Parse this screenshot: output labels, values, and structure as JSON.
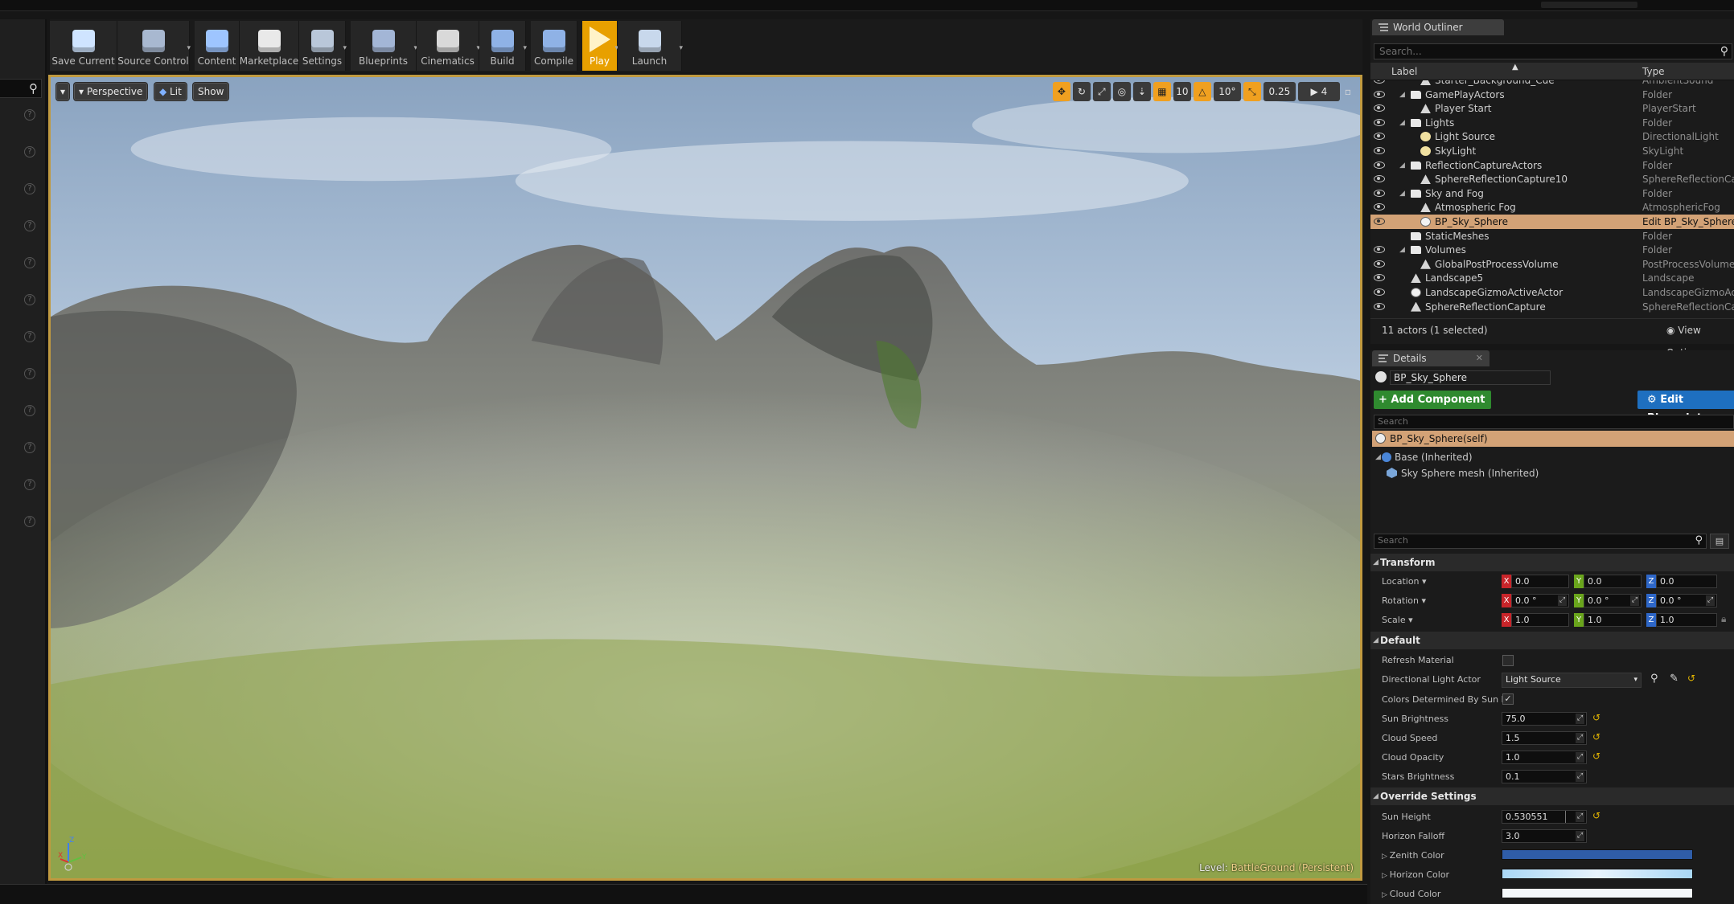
{
  "toolbar": {
    "buttons": [
      {
        "label": "Save Current",
        "icon": "save-icon"
      },
      {
        "label": "Source Control",
        "icon": "source-control-icon"
      },
      {
        "label": "Content",
        "icon": "content-icon"
      },
      {
        "label": "Marketplace",
        "icon": "marketplace-icon"
      },
      {
        "label": "Settings",
        "icon": "settings-icon"
      },
      {
        "label": "Blueprints",
        "icon": "blueprints-icon"
      },
      {
        "label": "Cinematics",
        "icon": "cinematics-icon"
      },
      {
        "label": "Build",
        "icon": "build-icon"
      },
      {
        "label": "Compile",
        "icon": "compile-icon"
      },
      {
        "label": "Play",
        "icon": "play-icon"
      },
      {
        "label": "Launch",
        "icon": "launch-icon"
      }
    ]
  },
  "viewport": {
    "perspective": "Perspective",
    "lit": "Lit",
    "show": "Show",
    "grid_snap": "10",
    "rotation_snap": "10°",
    "scale_snap": "0.25",
    "camera_speed": "4",
    "level_prefix": "Level:",
    "level_name": "BattleGround (Persistent)",
    "axis": {
      "x": "X",
      "y": "Y",
      "z": "Z"
    }
  },
  "outliner": {
    "title": "World Outliner",
    "search_placeholder": "Search...",
    "col_label": "Label",
    "col_type": "Type",
    "rows": [
      {
        "label": "Starter_Background_Cue",
        "type": "AmbientSound",
        "indent": 2,
        "kind": "actor",
        "partial": true
      },
      {
        "label": "GamePlayActors",
        "type": "Folder",
        "indent": 1,
        "kind": "folder"
      },
      {
        "label": "Player Start",
        "type": "PlayerStart",
        "indent": 2,
        "kind": "actor"
      },
      {
        "label": "Lights",
        "type": "Folder",
        "indent": 1,
        "kind": "folder"
      },
      {
        "label": "Light Source",
        "type": "DirectionalLight",
        "indent": 2,
        "kind": "light"
      },
      {
        "label": "SkyLight",
        "type": "SkyLight",
        "indent": 2,
        "kind": "light"
      },
      {
        "label": "ReflectionCaptureActors",
        "type": "Folder",
        "indent": 1,
        "kind": "folder"
      },
      {
        "label": "SphereReflectionCapture10",
        "type": "SphereReflectionCapture",
        "indent": 2,
        "kind": "actor"
      },
      {
        "label": "Sky and Fog",
        "type": "Folder",
        "indent": 1,
        "kind": "folder"
      },
      {
        "label": "Atmospheric Fog",
        "type": "AtmosphericFog",
        "indent": 2,
        "kind": "actor"
      },
      {
        "label": "BP_Sky_Sphere",
        "type": "Edit BP_Sky_Sphere",
        "indent": 2,
        "kind": "sphere",
        "selected": true
      },
      {
        "label": "StaticMeshes",
        "type": "Folder",
        "indent": 1,
        "kind": "folder"
      },
      {
        "label": "Volumes",
        "type": "Folder",
        "indent": 1,
        "kind": "folder"
      },
      {
        "label": "GlobalPostProcessVolume",
        "type": "PostProcessVolume",
        "indent": 2,
        "kind": "actor"
      },
      {
        "label": "Landscape5",
        "type": "Landscape",
        "indent": 1,
        "kind": "actor"
      },
      {
        "label": "LandscapeGizmoActiveActor",
        "type": "LandscapeGizmoActiveActor",
        "indent": 1,
        "kind": "sphere"
      },
      {
        "label": "SphereReflectionCapture",
        "type": "SphereReflectionCapture",
        "indent": 1,
        "kind": "actor"
      }
    ],
    "status": "11 actors (1 selected)",
    "view_options": "View Options"
  },
  "details": {
    "title": "Details",
    "actor_name": "BP_Sky_Sphere",
    "add_component": "+ Add Component",
    "edit_blueprint": "Edit Blueprint",
    "component_search_placeholder": "Search",
    "components": {
      "self": "BP_Sky_Sphere(self)",
      "base": "Base (Inherited)",
      "mesh": "Sky Sphere mesh (Inherited)"
    },
    "property_search_placeholder": "Search",
    "transform": {
      "title": "Transform",
      "location_label": "Location",
      "rotation_label": "Rotation",
      "scale_label": "Scale",
      "location": [
        "0.0",
        "0.0",
        "0.0"
      ],
      "rotation": [
        "0.0 °",
        "0.0 °",
        "0.0 °"
      ],
      "scale": [
        "1.0",
        "1.0",
        "1.0"
      ]
    },
    "default": {
      "title": "Default",
      "refresh_material_label": "Refresh Material",
      "refresh_material": false,
      "directional_light_label": "Directional Light Actor",
      "directional_light_value": "Light Source",
      "colors_by_sun_label": "Colors Determined By Sun Po",
      "colors_by_sun": true,
      "sun_brightness_label": "Sun Brightness",
      "sun_brightness": "75.0",
      "cloud_speed_label": "Cloud Speed",
      "cloud_speed": "1.5",
      "cloud_opacity_label": "Cloud Opacity",
      "cloud_opacity": "1.0",
      "stars_brightness_label": "Stars Brightness",
      "stars_brightness": "0.1"
    },
    "override": {
      "title": "Override Settings",
      "sun_height_label": "Sun Height",
      "sun_height": "0.530551",
      "horizon_falloff_label": "Horizon Falloff",
      "horizon_falloff": "3.0",
      "zenith_color_label": "Zenith Color",
      "zenith_color": "#2f5da8",
      "horizon_color_label": "Horizon Color",
      "horizon_color": "#a9d7f6",
      "cloud_color_label": "Cloud Color",
      "cloud_color": "#f4f8fb"
    }
  },
  "colors": {
    "accent_orange": "#e8a000",
    "selection": "#d3a276",
    "add_component_green": "#2f8a2f",
    "edit_blueprint_blue": "#1e6fc0"
  }
}
